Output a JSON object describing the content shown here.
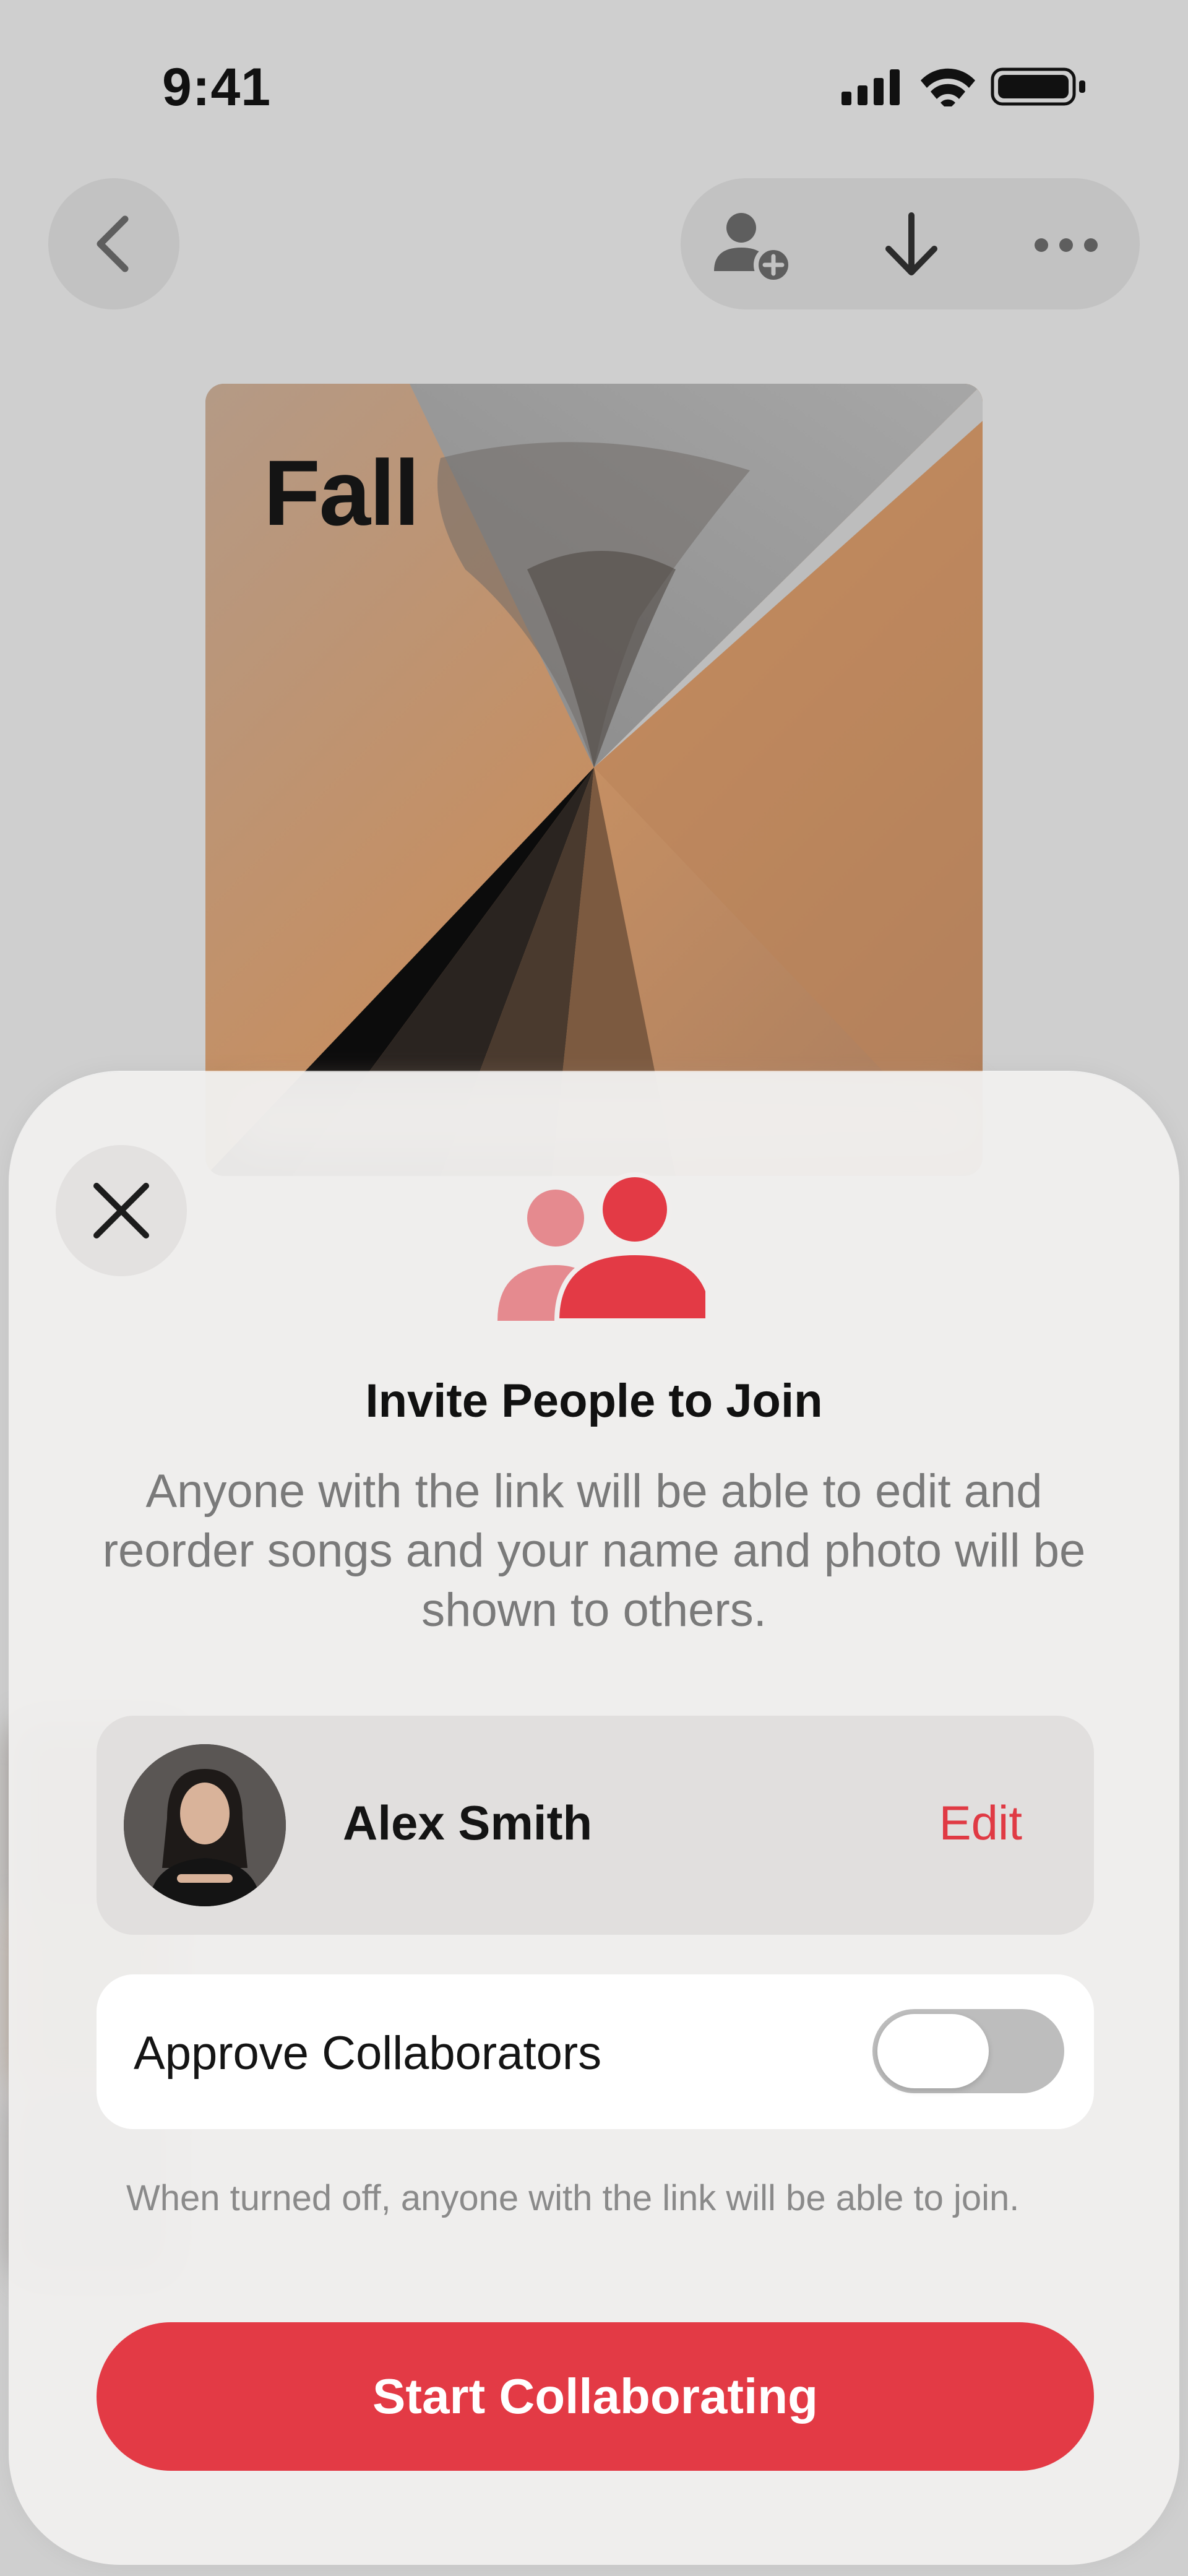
{
  "status_bar": {
    "time": "9:41",
    "icons": [
      "cellular-signal-icon",
      "wifi-icon",
      "battery-icon"
    ]
  },
  "nav": {
    "buttons": [
      "back-icon",
      "add-person-icon",
      "download-icon",
      "more-icon"
    ]
  },
  "playlist": {
    "cover_title": "Fall"
  },
  "sheet": {
    "close_icon": "close-icon",
    "header_icon": "people-icon",
    "title": "Invite People to Join",
    "description": "Anyone with the link will be able to edit and reorder songs and your name and photo will be shown to others.",
    "profile": {
      "name": "Alex Smith",
      "edit_label": "Edit"
    },
    "approve": {
      "label": "Approve Collaborators",
      "enabled": false,
      "footnote": "When turned off, anyone with the link will be able to join."
    },
    "primary_button_label": "Start Collaborating"
  },
  "colors": {
    "accent": "#e33a45",
    "edit_text": "#e03a44",
    "icon_secondary": "#e58a8f"
  }
}
